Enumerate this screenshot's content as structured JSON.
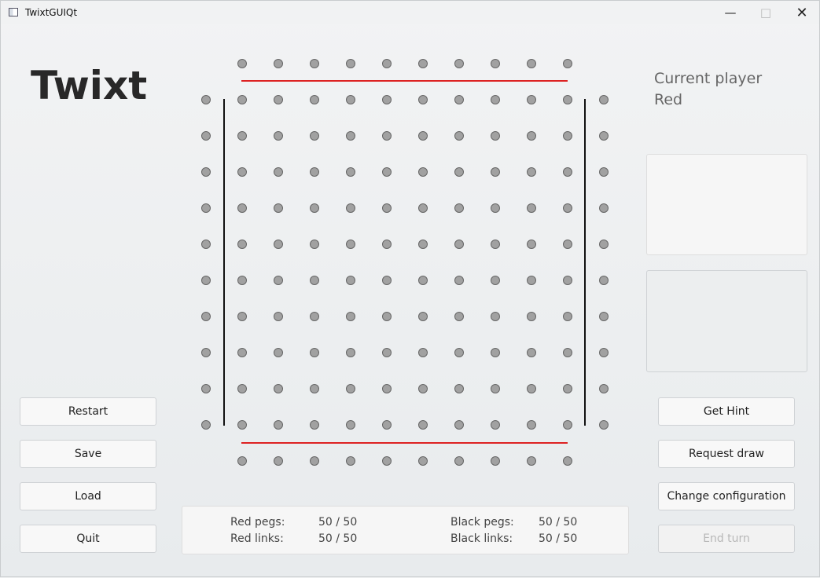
{
  "window": {
    "title": "TwixtGUIQt",
    "controls": {
      "minimize": "—",
      "maximize": "□",
      "close": "✕"
    }
  },
  "game": {
    "title": "Twixt"
  },
  "left_buttons": [
    "Restart",
    "Save",
    "Load",
    "Quit"
  ],
  "right_buttons": [
    "Get Hint",
    "Request draw",
    "Change configuration",
    "End turn"
  ],
  "current": {
    "label": "Current player",
    "value": "Red"
  },
  "stats": {
    "red_pegs_label": "Red pegs:",
    "red_pegs_value": "50 / 50",
    "red_links_label": "Red links:",
    "red_links_value": "50 / 50",
    "black_pegs_label": "Black pegs:",
    "black_pegs_value": "50 / 50",
    "black_links_label": "Black links:",
    "black_links_value": "50 / 50"
  },
  "board": {
    "rows": 12,
    "columns": 12,
    "empty_corners": true,
    "red_border_color": "#dd2222",
    "black_border_color": "#111111",
    "peg_color": "#a1a1a1"
  }
}
